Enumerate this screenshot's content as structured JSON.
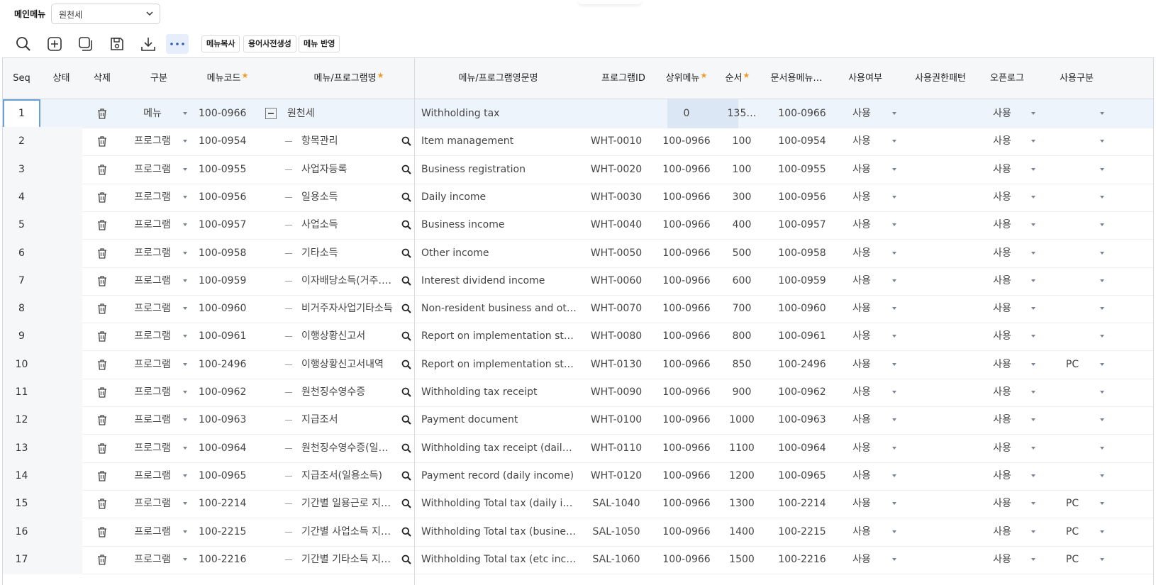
{
  "top": {
    "menu_label": "메인메뉴",
    "menu_select_value": "원천세"
  },
  "toolbar": {
    "icons": [
      "search-icon",
      "add-icon",
      "copy-icon",
      "save-icon",
      "download-icon",
      "more-icon"
    ],
    "buttons": [
      "메뉴복사",
      "용어사전생성",
      "메뉴 반영"
    ]
  },
  "columns": [
    "Seq",
    "상태",
    "삭제",
    "구분",
    "메뉴코드",
    "메뉴/프로그램명",
    "메뉴/프로그램영문명",
    "프로그램ID",
    "상위메뉴",
    "순서",
    "문서용메뉴…",
    "사용여부",
    "사용권한패턴",
    "오픈로그",
    "사용구분"
  ],
  "required_mark": "★",
  "rows": [
    {
      "seq": "1",
      "type": "메뉴",
      "code": "100-0966",
      "name": "원천세",
      "eng": "Withholding tax",
      "pid": "",
      "parent": "0",
      "order": "135…",
      "doc": "100-0966",
      "use": "사용",
      "perm": "",
      "log": "사용",
      "usetype": ""
    },
    {
      "seq": "2",
      "type": "프로그램",
      "code": "100-0954",
      "name": "항목관리",
      "eng": "Item management",
      "pid": "WHT-0010",
      "parent": "100-0966",
      "order": "100",
      "doc": "100-0954",
      "use": "사용",
      "perm": "",
      "log": "사용",
      "usetype": ""
    },
    {
      "seq": "3",
      "type": "프로그램",
      "code": "100-0955",
      "name": "사업자등록",
      "eng": "Business registration",
      "pid": "WHT-0020",
      "parent": "100-0966",
      "order": "100",
      "doc": "100-0955",
      "use": "사용",
      "perm": "",
      "log": "사용",
      "usetype": ""
    },
    {
      "seq": "4",
      "type": "프로그램",
      "code": "100-0956",
      "name": "일용소득",
      "eng": "Daily income",
      "pid": "WHT-0030",
      "parent": "100-0966",
      "order": "300",
      "doc": "100-0956",
      "use": "사용",
      "perm": "",
      "log": "사용",
      "usetype": ""
    },
    {
      "seq": "5",
      "type": "프로그램",
      "code": "100-0957",
      "name": "사업소득",
      "eng": "Business income",
      "pid": "WHT-0040",
      "parent": "100-0966",
      "order": "400",
      "doc": "100-0957",
      "use": "사용",
      "perm": "",
      "log": "사용",
      "usetype": ""
    },
    {
      "seq": "6",
      "type": "프로그램",
      "code": "100-0958",
      "name": "기타소득",
      "eng": "Other income",
      "pid": "WHT-0050",
      "parent": "100-0966",
      "order": "500",
      "doc": "100-0958",
      "use": "사용",
      "perm": "",
      "log": "사용",
      "usetype": ""
    },
    {
      "seq": "7",
      "type": "프로그램",
      "code": "100-0959",
      "name": "이자배당소득(거주.비…",
      "eng": "Interest dividend income",
      "pid": "WHT-0060",
      "parent": "100-0966",
      "order": "600",
      "doc": "100-0959",
      "use": "사용",
      "perm": "",
      "log": "사용",
      "usetype": ""
    },
    {
      "seq": "8",
      "type": "프로그램",
      "code": "100-0960",
      "name": "비거주자사업기타소득",
      "eng": "Non-resident business and other i…",
      "pid": "WHT-0070",
      "parent": "100-0966",
      "order": "700",
      "doc": "100-0960",
      "use": "사용",
      "perm": "",
      "log": "사용",
      "usetype": ""
    },
    {
      "seq": "9",
      "type": "프로그램",
      "code": "100-0961",
      "name": "이행상황신고서",
      "eng": "Report on implementation status",
      "pid": "WHT-0080",
      "parent": "100-0966",
      "order": "800",
      "doc": "100-0961",
      "use": "사용",
      "perm": "",
      "log": "사용",
      "usetype": ""
    },
    {
      "seq": "10",
      "type": "프로그램",
      "code": "100-2496",
      "name": "이행상황신고서내역",
      "eng": "Report on implementation status",
      "pid": "WHT-0130",
      "parent": "100-0966",
      "order": "850",
      "doc": "100-2496",
      "use": "사용",
      "perm": "",
      "log": "사용",
      "usetype": "PC"
    },
    {
      "seq": "11",
      "type": "프로그램",
      "code": "100-0962",
      "name": "원천징수영수증",
      "eng": "Withholding tax receipt",
      "pid": "WHT-0090",
      "parent": "100-0966",
      "order": "900",
      "doc": "100-0962",
      "use": "사용",
      "perm": "",
      "log": "사용",
      "usetype": ""
    },
    {
      "seq": "12",
      "type": "프로그램",
      "code": "100-0963",
      "name": "지급조서",
      "eng": "Payment document",
      "pid": "WHT-0100",
      "parent": "100-0966",
      "order": "1000",
      "doc": "100-0963",
      "use": "사용",
      "perm": "",
      "log": "사용",
      "usetype": ""
    },
    {
      "seq": "13",
      "type": "프로그램",
      "code": "100-0964",
      "name": "원천징수영수증(일용…",
      "eng": "Withholding tax receipt (daily inco…",
      "pid": "WHT-0110",
      "parent": "100-0966",
      "order": "1100",
      "doc": "100-0964",
      "use": "사용",
      "perm": "",
      "log": "사용",
      "usetype": ""
    },
    {
      "seq": "14",
      "type": "프로그램",
      "code": "100-0965",
      "name": "지급조서(일용소득)",
      "eng": "Payment record (daily income)",
      "pid": "WHT-0120",
      "parent": "100-0966",
      "order": "1200",
      "doc": "100-0965",
      "use": "사용",
      "perm": "",
      "log": "사용",
      "usetype": ""
    },
    {
      "seq": "15",
      "type": "프로그램",
      "code": "100-2214",
      "name": "기간별 일용근로 지급…",
      "eng": "Withholding Total tax (daily income)",
      "pid": "SAL-1040",
      "parent": "100-0966",
      "order": "1300",
      "doc": "100-2214",
      "use": "사용",
      "perm": "",
      "log": "사용",
      "usetype": "PC"
    },
    {
      "seq": "16",
      "type": "프로그램",
      "code": "100-2215",
      "name": "기간별 사업소득 지급…",
      "eng": "Withholding Total tax (business inc…",
      "pid": "SAL-1050",
      "parent": "100-0966",
      "order": "1400",
      "doc": "100-2215",
      "use": "사용",
      "perm": "",
      "log": "사용",
      "usetype": "PC"
    },
    {
      "seq": "17",
      "type": "프로그램",
      "code": "100-2216",
      "name": "기간별 기타소득 지급…",
      "eng": "Withholding Total tax (etc income)",
      "pid": "SAL-1060",
      "parent": "100-0966",
      "order": "1500",
      "doc": "100-2216",
      "use": "사용",
      "perm": "",
      "log": "사용",
      "usetype": "PC"
    }
  ]
}
